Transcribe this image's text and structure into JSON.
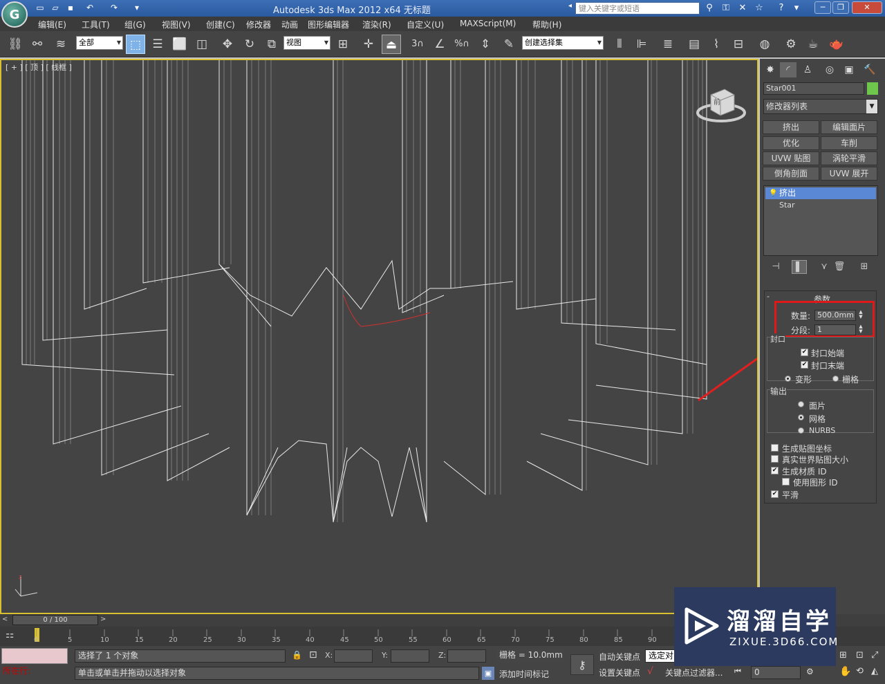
{
  "titlebar": {
    "app_title": "Autodesk 3ds Max  2012 x64     无标题",
    "search_placeholder": "键入关键字或短语",
    "logo": "G"
  },
  "menu": [
    "编辑(E)",
    "工具(T)",
    "组(G)",
    "视图(V)",
    "创建(C)",
    "修改器",
    "动画",
    "图形编辑器",
    "渲染(R)",
    "自定义(U)",
    "MAXScript(M)",
    "帮助(H)"
  ],
  "toolbar": {
    "selection_filter": "全部",
    "ref_coord": "视图",
    "named_selection": "创建选择集",
    "snap_label": "3",
    "angle_snap_label": "%"
  },
  "viewport": {
    "label": "[ + ] [ 顶 ] [ 线框 ]",
    "viewcube_label": "前"
  },
  "command_panel": {
    "object_name": "Star001",
    "object_color": "#6ec64c",
    "modifier_list": "修改器列表",
    "modifier_buttons": [
      "挤出",
      "编辑面片",
      "优化",
      "车削",
      "UVW 贴图",
      "涡轮平滑",
      "倒角剖面",
      "UVW 展开"
    ],
    "stack": {
      "selected": "挤出",
      "base": "Star"
    },
    "rollout_title": "参数",
    "amount_label": "数量:",
    "amount_value": "500.0mm",
    "segments_label": "分段:",
    "segments_value": "1",
    "capping_group": "封口",
    "cap_start": "封口始端",
    "cap_end": "封口末端",
    "morph": "变形",
    "grid": "栅格",
    "output_group": "输出",
    "out_patch": "面片",
    "out_mesh": "网格",
    "out_nurbs": "NURBS",
    "gen_mapping": "生成贴图坐标",
    "real_world": "真实世界贴图大小",
    "gen_mat_ids": "生成材质 ID",
    "use_shape_ids": "使用图形 ID",
    "smooth": "平滑"
  },
  "timeline": {
    "slider": "0 / 100",
    "ticks": [
      "0",
      "5",
      "10",
      "15",
      "20",
      "25",
      "30",
      "35",
      "40",
      "45",
      "50",
      "55",
      "60",
      "65",
      "70",
      "75",
      "80",
      "85",
      "90"
    ]
  },
  "status": {
    "selected": "选择了 1 个对象",
    "prompt": "单击或单击并拖动以选择对象",
    "x_label": "X:",
    "y_label": "Y:",
    "z_label": "Z:",
    "grid": "栅格 = 10.0mm",
    "auto_key": "自动关键点",
    "set_key": "设置关键点",
    "selected_dd": "选定对",
    "key_filters": "关键点过滤器...",
    "add_time_tag": "添加时间标记",
    "current_frame": "0",
    "script_label": "所在行:"
  },
  "watermark": {
    "title": "溜溜自学",
    "url": "ZIXUE.3D66.COM"
  }
}
